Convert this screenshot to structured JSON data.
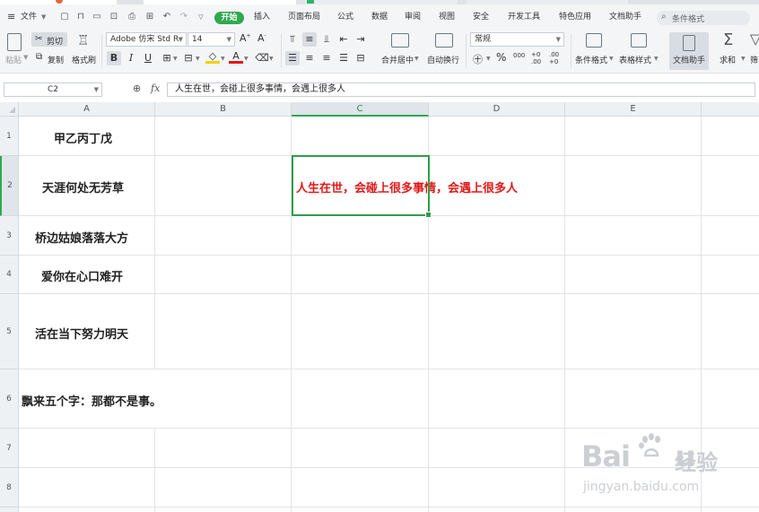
{
  "menu": {
    "file": "文件",
    "start": "开始",
    "tabs": [
      "插入",
      "页面布局",
      "公式",
      "数据",
      "审阅",
      "视图",
      "安全",
      "开发工具",
      "特色应用",
      "文档助手"
    ],
    "search_placeholder": "条件格式"
  },
  "ribbon": {
    "paste": "粘贴",
    "cut": "剪切",
    "copy": "复制",
    "format_painter": "格式刷",
    "font_name": "Adobe 仿宋 Std R",
    "font_size": "14",
    "bold": "B",
    "italic": "I",
    "underline": "U",
    "merge_center": "合并居中",
    "wrap_text": "自动换行",
    "number_format": "常规",
    "percent": "%",
    "thousands": "000",
    "inc_decimal": "+0 .00",
    "dec_decimal": ".00 +0",
    "conditional_format": "条件格式",
    "table_style": "表格样式",
    "doc_helper": "文档助手",
    "sum": "求和",
    "filter": "筛"
  },
  "formula_bar": {
    "name_box": "C2",
    "fx": "fx",
    "content": "人生在世，会碰上很多事情，会遇上很多人"
  },
  "sheet": {
    "columns": [
      "A",
      "B",
      "C",
      "D",
      "E"
    ],
    "rows": [
      "1",
      "2",
      "3",
      "4",
      "5",
      "6",
      "7",
      "8"
    ],
    "a1": "甲乙丙丁戊",
    "a2": "天涯何处无芳草",
    "c2": "人生在世，会碰上很多事情，会遇上很多人",
    "a3": "桥边姑娘落落大方",
    "a4": "爱你在心口难开",
    "a5": "活在当下努力明天",
    "a6": "飘来五个字：那都不是事。"
  },
  "watermark": {
    "logo": "Baidu经验",
    "url": "jingyan.baidu.com"
  }
}
